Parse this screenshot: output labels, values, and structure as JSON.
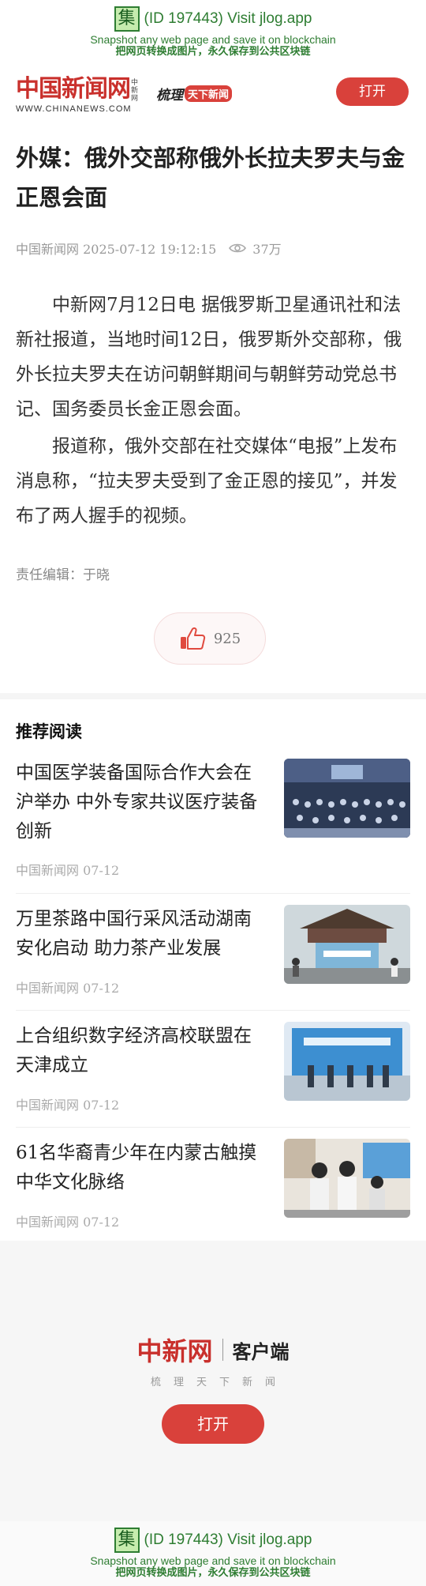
{
  "jlog": {
    "badge": "集",
    "id_text": "(ID 197443) Visit jlog.app",
    "line2": "Snapshot any web page and save it on blockchain",
    "line3": "把网页转换成图片，永久保存到公共区块链"
  },
  "header": {
    "logo_cn": "中国新闻网",
    "logo_side": "中新网",
    "logo_en": "WWW.CHINANEWS.COM",
    "slogan_a": "梳理",
    "slogan_b": "天下新闻",
    "open_label": "打开"
  },
  "article": {
    "title": "外媒：俄外交部称俄外长拉夫罗夫与金正恩会面",
    "source_time": "中国新闻网 2025-07-12 19:12:15",
    "views": "37万",
    "paragraphs": [
      "中新网7月12日电 据俄罗斯卫星通讯社和法新社报道，当地时间12日，俄罗斯外交部称，俄外长拉夫罗夫在访问朝鲜期间与朝鲜劳动党总书记、国务委员长金正恩会面。",
      "报道称，俄外交部在社交媒体“电报”上发布消息称，“拉夫罗夫受到了金正恩的接见”，并发布了两人握手的视频。"
    ],
    "editor": "责任编辑：于晓",
    "likes": "925"
  },
  "recommend": {
    "heading": "推荐阅读",
    "items": [
      {
        "title": "中国医学装备国际合作大会在沪举办 中外专家共议医疗装备创新",
        "source": "中国新闻网 07-12"
      },
      {
        "title": "万里茶路中国行采风活动湖南安化启动 助力茶产业发展",
        "source": "中国新闻网 07-12"
      },
      {
        "title": "上合组织数字经济高校联盟在天津成立",
        "source": "中国新闻网 07-12"
      },
      {
        "title": "61名华裔青少年在内蒙古触摸中华文化脉络",
        "source": "中国新闻网 07-12"
      }
    ]
  },
  "promo": {
    "brand": "中新网",
    "client": "客户端",
    "tagline": "梳理天下新闻",
    "open_label": "打开"
  },
  "colors": {
    "accent_red": "#d9413b",
    "jlog_green": "#2e7d32"
  }
}
